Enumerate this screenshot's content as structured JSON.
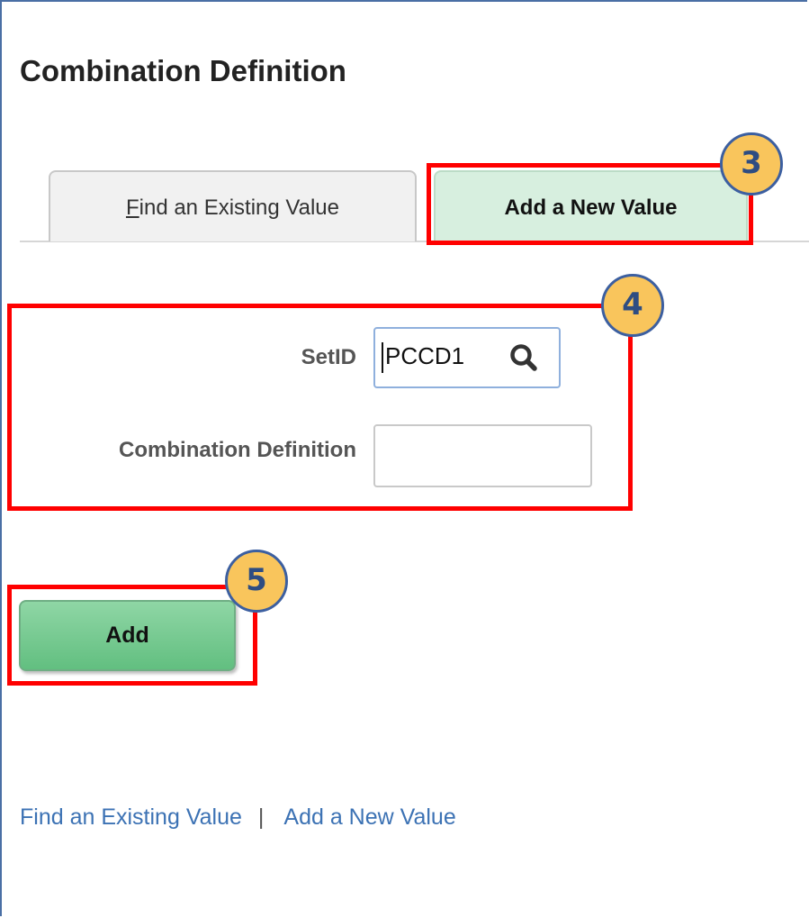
{
  "page": {
    "title": "Combination Definition"
  },
  "tabs": {
    "find_prefix_underlined": "F",
    "find_rest": "ind an Existing Value",
    "add": "Add a New Value"
  },
  "form": {
    "setid_label": "SetID",
    "setid_value": "PCCD1",
    "combination_label": "Combination Definition",
    "combination_value": ""
  },
  "actions": {
    "add_label": "Add"
  },
  "footer": {
    "find_link": "Find an Existing Value",
    "separator": "|",
    "add_link": "Add a New Value"
  },
  "callouts": {
    "step_tab": "3",
    "step_form": "4",
    "step_add": "5"
  },
  "colors": {
    "highlight": "#ff0000",
    "callout_fill": "#f9c55c",
    "callout_border": "#3c5fa0",
    "active_tab": "#d7efdf",
    "add_button": "#62bf80",
    "link": "#3c72b4"
  },
  "icons": {
    "lookup": "magnifier-icon"
  }
}
